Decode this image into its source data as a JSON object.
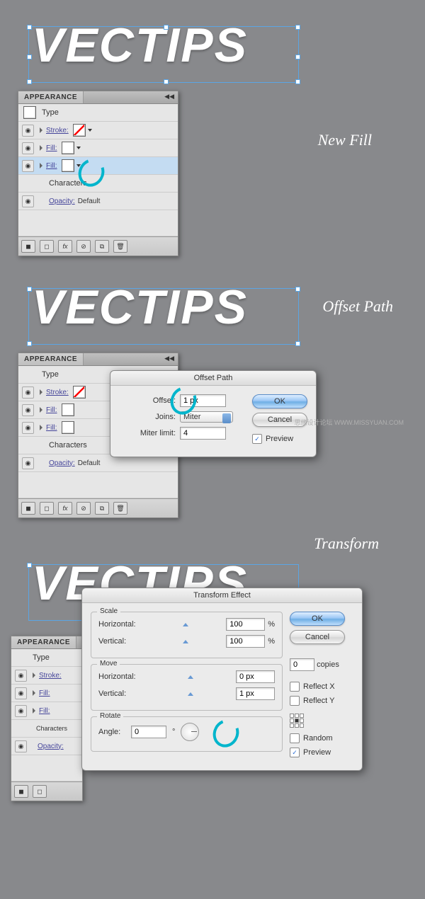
{
  "sections": {
    "newFill": {
      "annotation": "New Fill",
      "vectips": "VECTIPS"
    },
    "offsetPath": {
      "annotation": "Offset Path",
      "vectips": "VECTIPS"
    },
    "transform": {
      "annotation": "Transform",
      "vectips": "VECTIPS"
    }
  },
  "appearance": {
    "title": "APPEARANCE",
    "type": "Type",
    "stroke": "Stroke:",
    "fill": "Fill:",
    "characters": "Characters",
    "opacity": "Opacity:",
    "default": "Default",
    "fxLabel": "fx"
  },
  "offsetDialog": {
    "title": "Offset Path",
    "offsetLabel": "Offset:",
    "offsetValue": "1 px",
    "joinsLabel": "Joins:",
    "joinsValue": "Miter",
    "miterLabel": "Miter limit:",
    "miterValue": "4",
    "ok": "OK",
    "cancel": "Cancel",
    "preview": "Preview"
  },
  "transformDialog": {
    "title": "Transform Effect",
    "scale": "Scale",
    "move": "Move",
    "rotate": "Rotate",
    "horizontal": "Horizontal:",
    "vertical": "Vertical:",
    "angle": "Angle:",
    "scaleH": "100",
    "scaleV": "100",
    "moveH": "0 px",
    "moveV": "1 px",
    "angleVal": "0",
    "percent": "%",
    "deg": "°",
    "ok": "OK",
    "cancel": "Cancel",
    "copies": "copies",
    "copiesVal": "0",
    "reflectX": "Reflect X",
    "reflectY": "Reflect Y",
    "random": "Random",
    "preview": "Preview"
  },
  "watermark": {
    "cn": "思缘设计论坛",
    "url": "WWW.MISSYUAN.COM"
  }
}
